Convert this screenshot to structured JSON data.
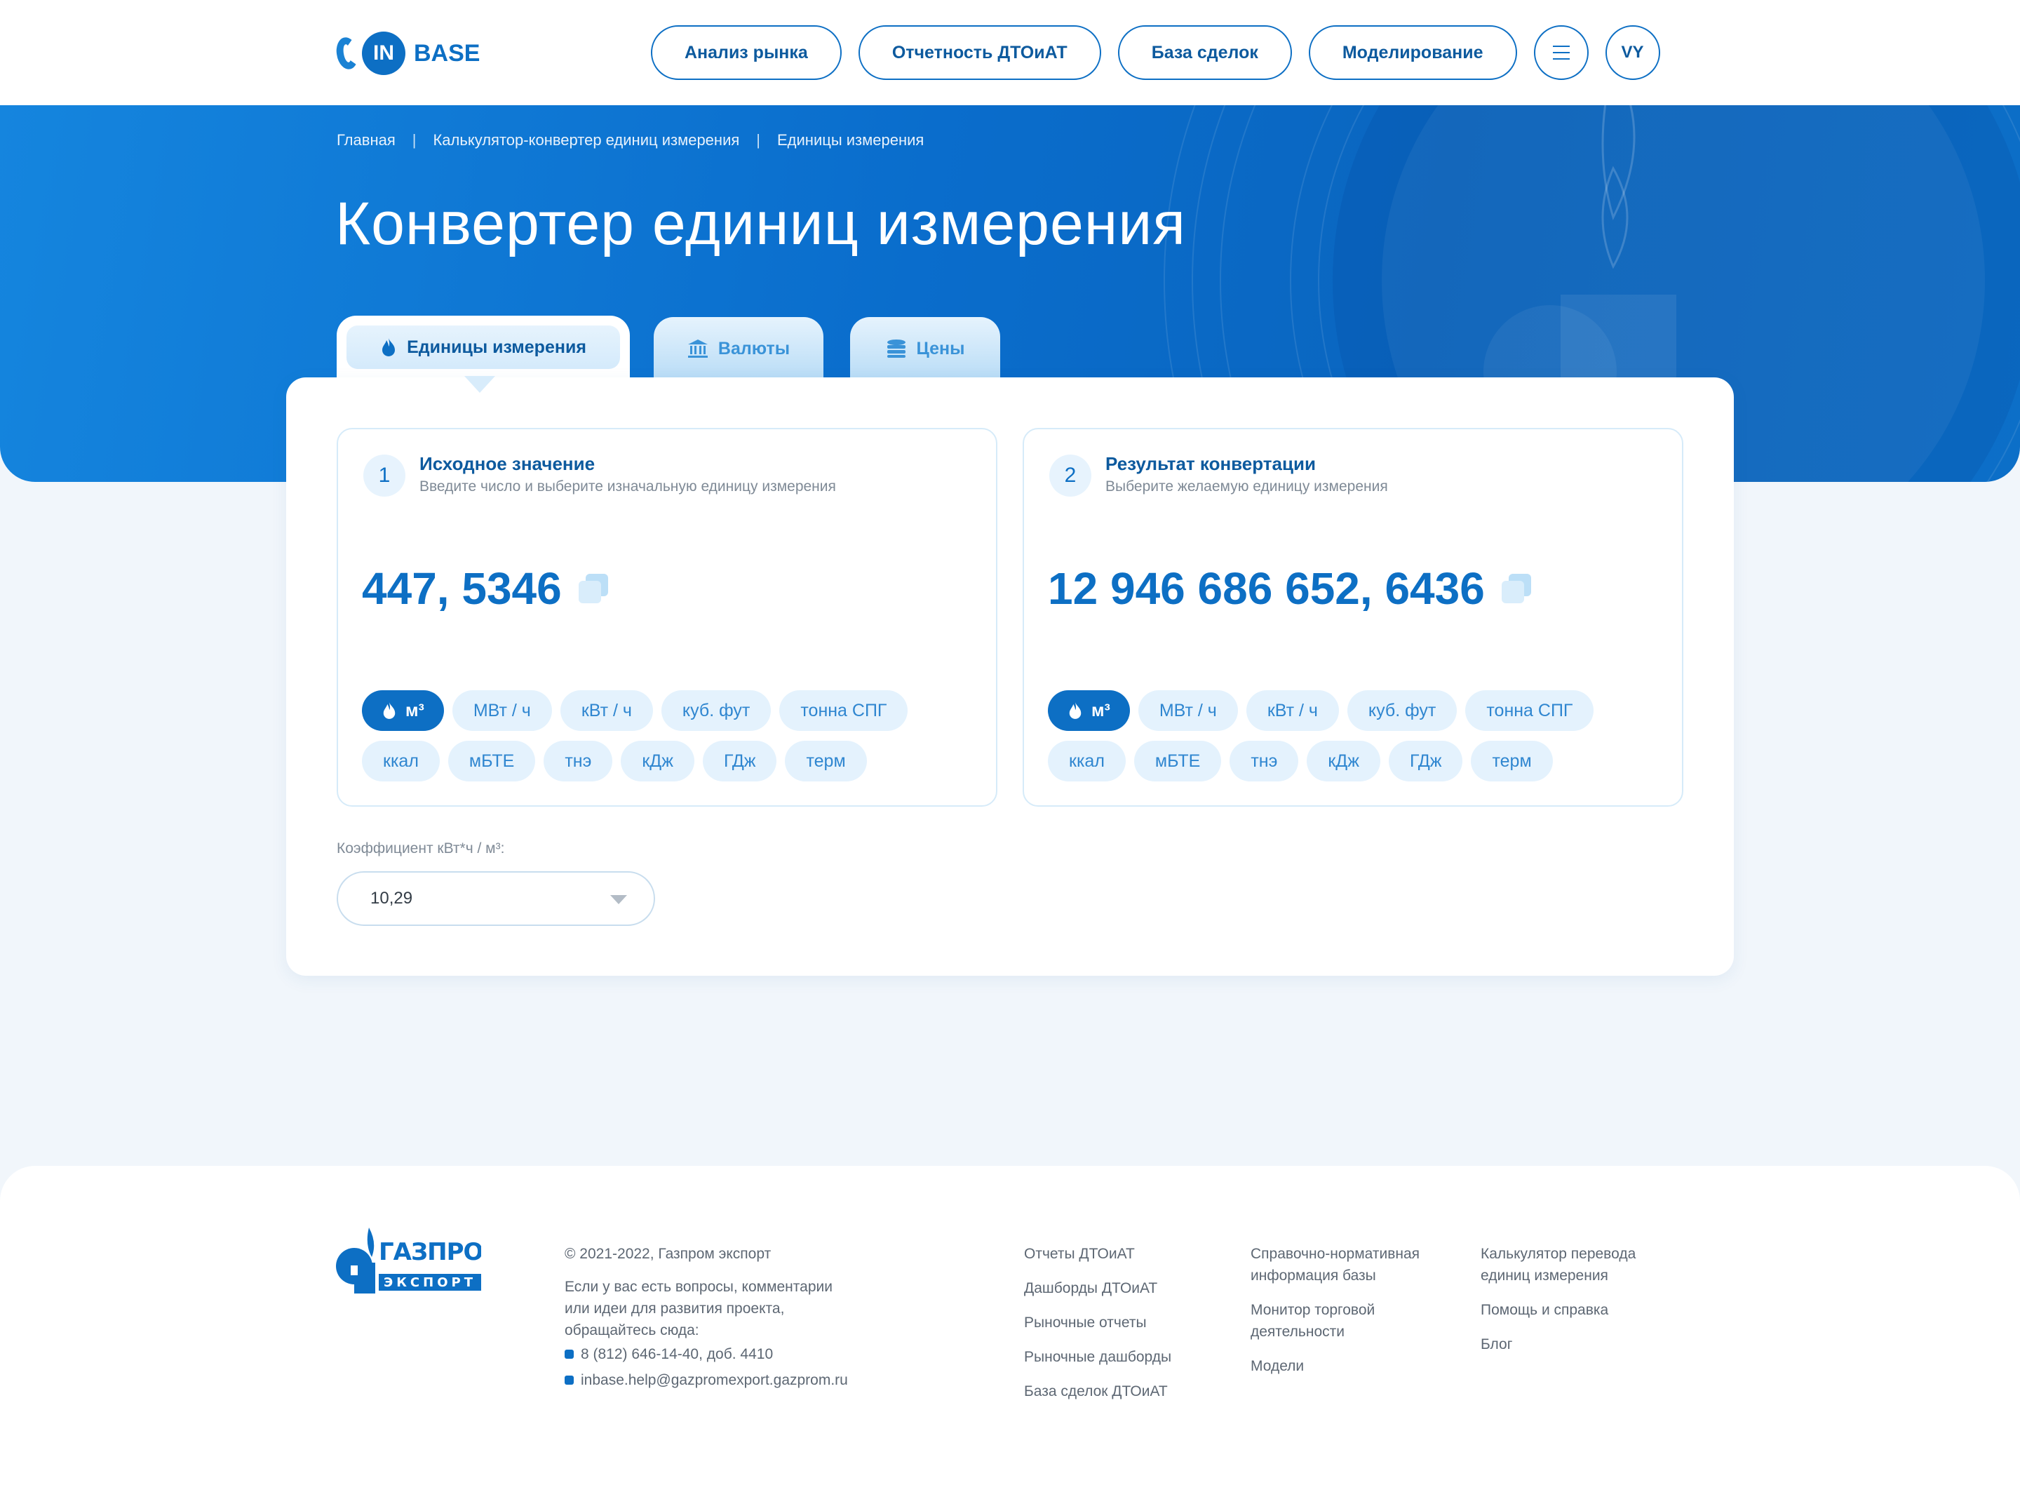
{
  "header": {
    "logo_text": "IN",
    "logo_base": "BASE",
    "nav": [
      "Анализ рынка",
      "Отчетность ДТОиАТ",
      "База сделок",
      "Моделирование"
    ],
    "user_initials": "VY"
  },
  "breadcrumb": [
    "Главная",
    "Калькулятор-конвертер единиц измерения",
    "Единицы измерения"
  ],
  "breadcrumb_sep": "|",
  "page_title": "Конвертер единиц измерения",
  "tabs": [
    {
      "label": "Единицы измерения",
      "icon": "flame-icon",
      "active": true
    },
    {
      "label": "Валюты",
      "icon": "bank-icon",
      "active": false
    },
    {
      "label": "Цены",
      "icon": "coins-icon",
      "active": false
    }
  ],
  "source": {
    "step": "1",
    "title": "Исходное значение",
    "subtitle": "Введите число и выберите изначальную единицу измерения",
    "value": "447, 5346",
    "selected_unit": "м³"
  },
  "result": {
    "step": "2",
    "title": "Результат конвертации",
    "subtitle": "Выберите желаемую единицу измерения",
    "value": "12 946 686 652, 6436",
    "selected_unit": "м³"
  },
  "units_row1": [
    "м³",
    "МВт / ч",
    "кВт / ч",
    "куб. фут",
    "тонна СПГ"
  ],
  "units_row2": [
    "ккал",
    "мБТЕ",
    "тнэ",
    "кДж",
    "ГДж",
    "терм"
  ],
  "coefficient": {
    "label": "Коэффициент кВт*ч / м³:",
    "value": "10,29"
  },
  "footer": {
    "brand_top": "ГАЗПРОМ",
    "brand_bottom": "ЭКСПОРТ",
    "copyright": "© 2021-2022, Газпром экспорт",
    "feedback_1": "Если у вас есть вопросы, комментарии",
    "feedback_2": "или идеи для развития проекта,",
    "feedback_3": "обращайтесь сюда:",
    "phone": "8 (812) 646-14-40, доб. 4410",
    "email": "inbase.help@gazpromexport.gazprom.ru",
    "col2": [
      "Отчеты ДТОиАТ",
      "Дашборды ДТОиАТ",
      "Рыночные отчеты",
      "Рыночные дашборды",
      "База сделок ДТОиАТ"
    ],
    "col3": [
      [
        "Справочно-нормативная",
        "информация базы"
      ],
      [
        "Монитор торговой",
        "деятельности"
      ],
      [
        "Модели"
      ]
    ],
    "col4": [
      [
        "Калькулятор перевода",
        "единиц измерения"
      ],
      [
        "Помощь и справка"
      ],
      [
        "Блог"
      ]
    ]
  },
  "colors": {
    "primary": "#0d6fc4",
    "hero": "#0a6dcc",
    "chip": "#e4f2fd",
    "background": "#f1f6fb"
  }
}
